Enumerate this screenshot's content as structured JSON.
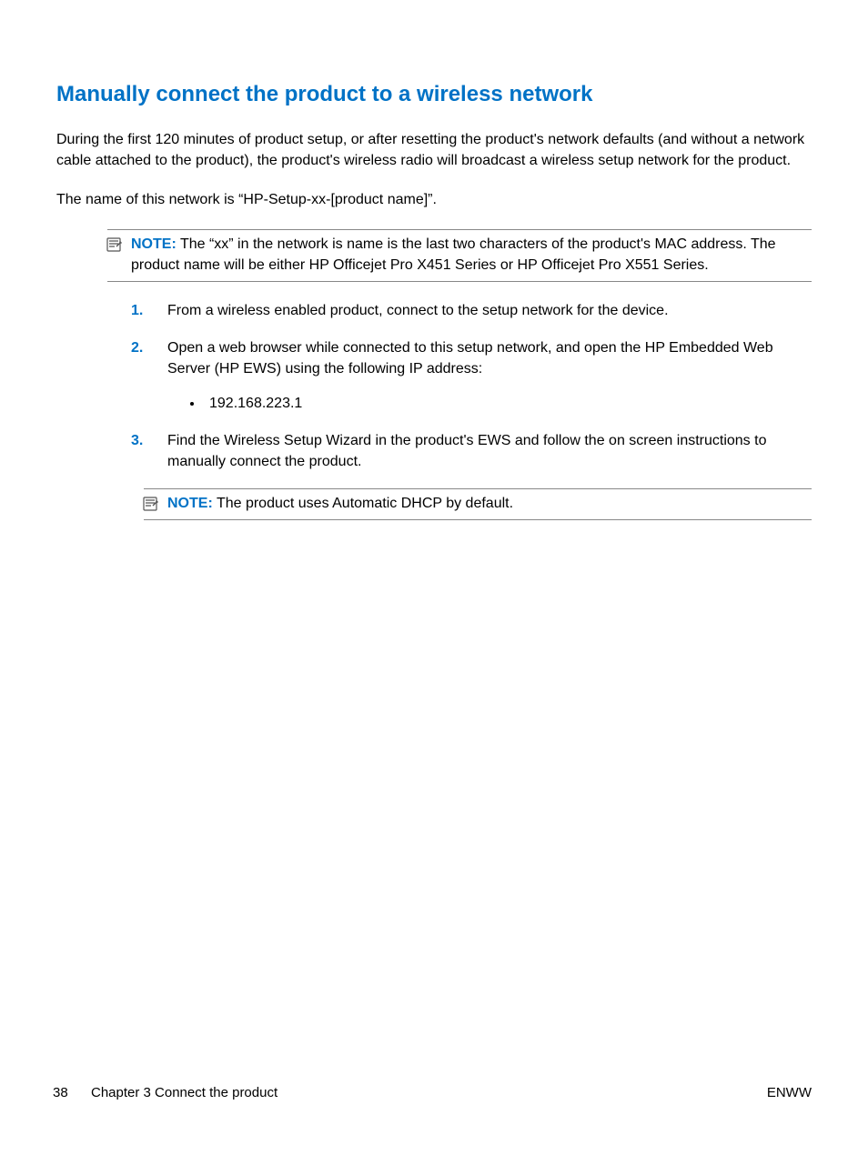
{
  "heading": "Manually connect the product to a wireless network",
  "para1": "During the first 120 minutes of product setup, or after resetting the product's network defaults (and without a network cable attached to the product), the product's wireless radio will broadcast a wireless setup network for the product.",
  "para2": "The name of this network is “HP-Setup-xx-[product name]”.",
  "note1": {
    "label": "NOTE:",
    "text": "The “xx” in the network is name is the last two characters of the product's MAC address. The product name will be either HP Officejet Pro X451 Series or HP Officejet Pro X551 Series."
  },
  "steps": {
    "s1": "From a wireless enabled product, connect to the setup network for the device.",
    "s2": "Open a web browser while connected to this setup network, and open the HP Embedded Web Server (HP EWS) using the following IP address:",
    "s2_bullet": "192.168.223.1",
    "s3": "Find the Wireless Setup Wizard in the product's EWS and follow the on screen instructions to manually connect the product."
  },
  "note2": {
    "label": "NOTE:",
    "text": "The product uses Automatic DHCP by default."
  },
  "footer": {
    "page": "38",
    "chapter": "Chapter 3   Connect the product",
    "lang": "ENWW"
  }
}
